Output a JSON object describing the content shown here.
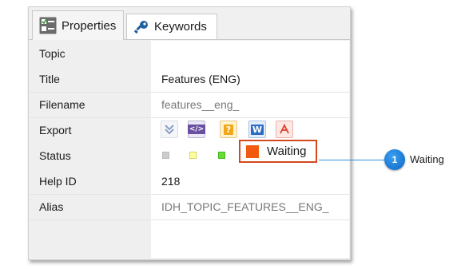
{
  "tabs": {
    "properties": {
      "label": "Properties",
      "icon": "properties-icon"
    },
    "keywords": {
      "label": "Keywords",
      "icon": "key-icon"
    }
  },
  "rows": {
    "topic": {
      "label": "Topic"
    },
    "title": {
      "label": "Title",
      "value": "Features (ENG)"
    },
    "filename": {
      "label": "Filename",
      "value": "features__eng_"
    },
    "export": {
      "label": "Export",
      "icons": [
        "checkmark-icon",
        "code-icon",
        "help-icon",
        "word-icon",
        "pdf-icon"
      ]
    },
    "status": {
      "label": "Status",
      "value": "Waiting",
      "color": "#f15a0f",
      "swatches": [
        "#cccccc",
        "#ffff99",
        "#66dd33"
      ]
    },
    "help_id": {
      "label": "Help ID",
      "value": "218"
    },
    "alias": {
      "label": "Alias",
      "value": "IDH_TOPIC_FEATURES__ENG_"
    }
  },
  "callout": {
    "number": "1",
    "label": "Waiting",
    "color": "#1478d8"
  }
}
